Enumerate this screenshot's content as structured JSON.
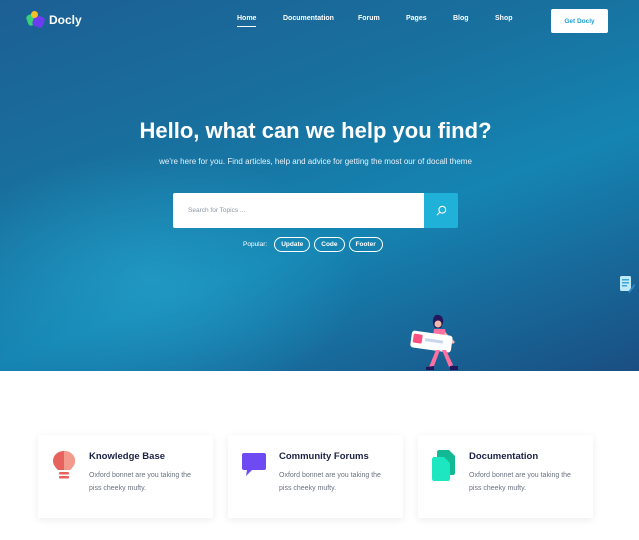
{
  "brand": {
    "name": "Docly"
  },
  "nav": {
    "items": [
      {
        "label": "Home",
        "active": true
      },
      {
        "label": "Documentation",
        "active": false
      },
      {
        "label": "Forum",
        "active": false
      },
      {
        "label": "Pages",
        "active": false
      },
      {
        "label": "Blog",
        "active": false
      },
      {
        "label": "Shop",
        "active": false
      }
    ],
    "cta_label": "Get Docly"
  },
  "hero": {
    "title": "Hello, what can we help you find?",
    "subtitle": "we're here for you. Find articles, help and advice for getting the most our of docall theme",
    "search": {
      "placeholder": "Search for Topics ...",
      "value": "",
      "button_icon": "search-icon"
    },
    "popular_label": "Popular:",
    "tags": [
      "Update",
      "Code",
      "Footer"
    ]
  },
  "features": [
    {
      "title": "Knowledge Base",
      "text": "Oxford bonnet are you taking the piss cheeky mufty.",
      "icon": "lightbulb-icon",
      "color": "#e8625d"
    },
    {
      "title": "Community Forums",
      "text": "Oxford bonnet are you taking the piss cheeky mufty.",
      "icon": "chat-bubble-icon",
      "color": "#6e4af2"
    },
    {
      "title": "Documentation",
      "text": "Oxford bonnet are you taking the piss cheeky mufty.",
      "icon": "documents-icon",
      "color": "#1bd6b2"
    }
  ],
  "colors": {
    "accent": "#1fb1d8",
    "hero_start": "#1c5f94",
    "hero_end": "#1a4e82",
    "heading": "#1c2146"
  }
}
